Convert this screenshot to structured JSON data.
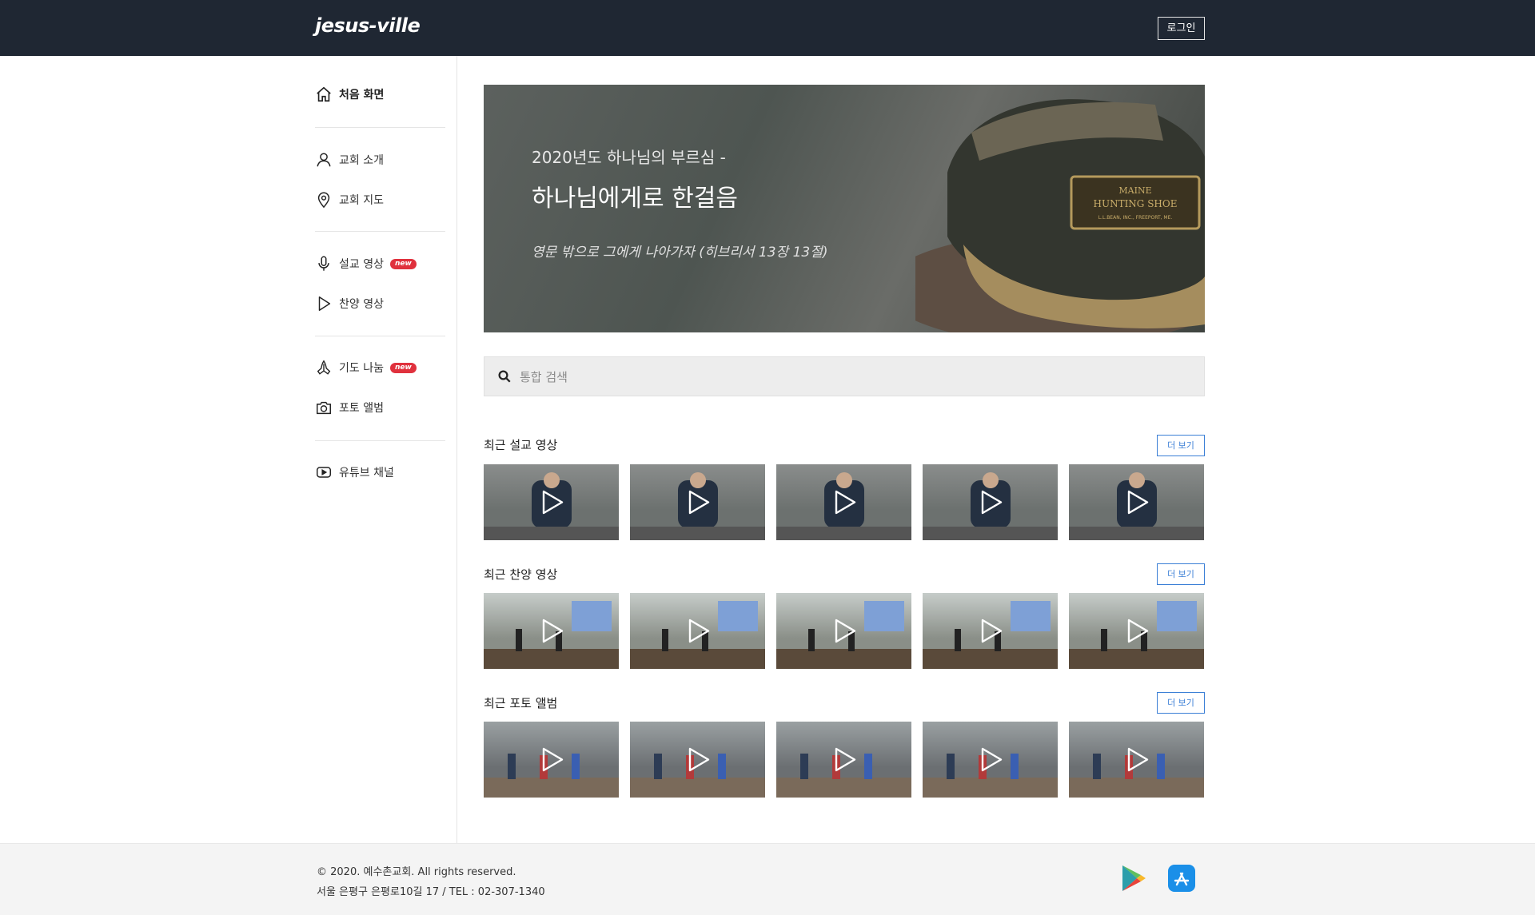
{
  "header": {
    "logo": "jesus-ville",
    "login_label": "로그인"
  },
  "sidebar": {
    "home": "처음 화면",
    "items": [
      {
        "label": "교회 소개",
        "icon": "person-icon"
      },
      {
        "label": "교회 지도",
        "icon": "map-pin-icon"
      },
      {
        "label": "설교 영상",
        "icon": "microphone-icon",
        "badge": "new"
      },
      {
        "label": "찬양 영상",
        "icon": "play-icon"
      },
      {
        "label": "기도 나눔",
        "icon": "praying-hands-icon",
        "badge": "new"
      },
      {
        "label": "포토 앨범",
        "icon": "camera-icon"
      },
      {
        "label": "유튜브 채널",
        "icon": "youtube-icon"
      }
    ]
  },
  "hero": {
    "subtitle": "2020년도 하나님의 부르심 -",
    "title": "하나님에게로 한걸음",
    "verse": "영문 밖으로 그에게 나아가자 (히브리서 13장 13절)",
    "shoe_label": "MAINE HUNTING SHOE L.L.BEAN, INC., FREEPORT, ME."
  },
  "search": {
    "placeholder": "통합 검색"
  },
  "sections": [
    {
      "title": "최근 설교 영상",
      "more": "더 보기"
    },
    {
      "title": "최근 찬양 영상",
      "more": "더 보기"
    },
    {
      "title": "최근 포토 앨범",
      "more": "더 보기"
    }
  ],
  "footer": {
    "copyright": "© 2020. 예수촌교회. All rights reserved.",
    "address": "서울 은평구 은평로10길 17 / TEL : 02-307-1340",
    "apps": [
      "google-play-icon",
      "app-store-icon"
    ]
  },
  "colors": {
    "topbar": "#1f2733",
    "accent": "#3b7fd6",
    "badge": "#e0313d"
  }
}
